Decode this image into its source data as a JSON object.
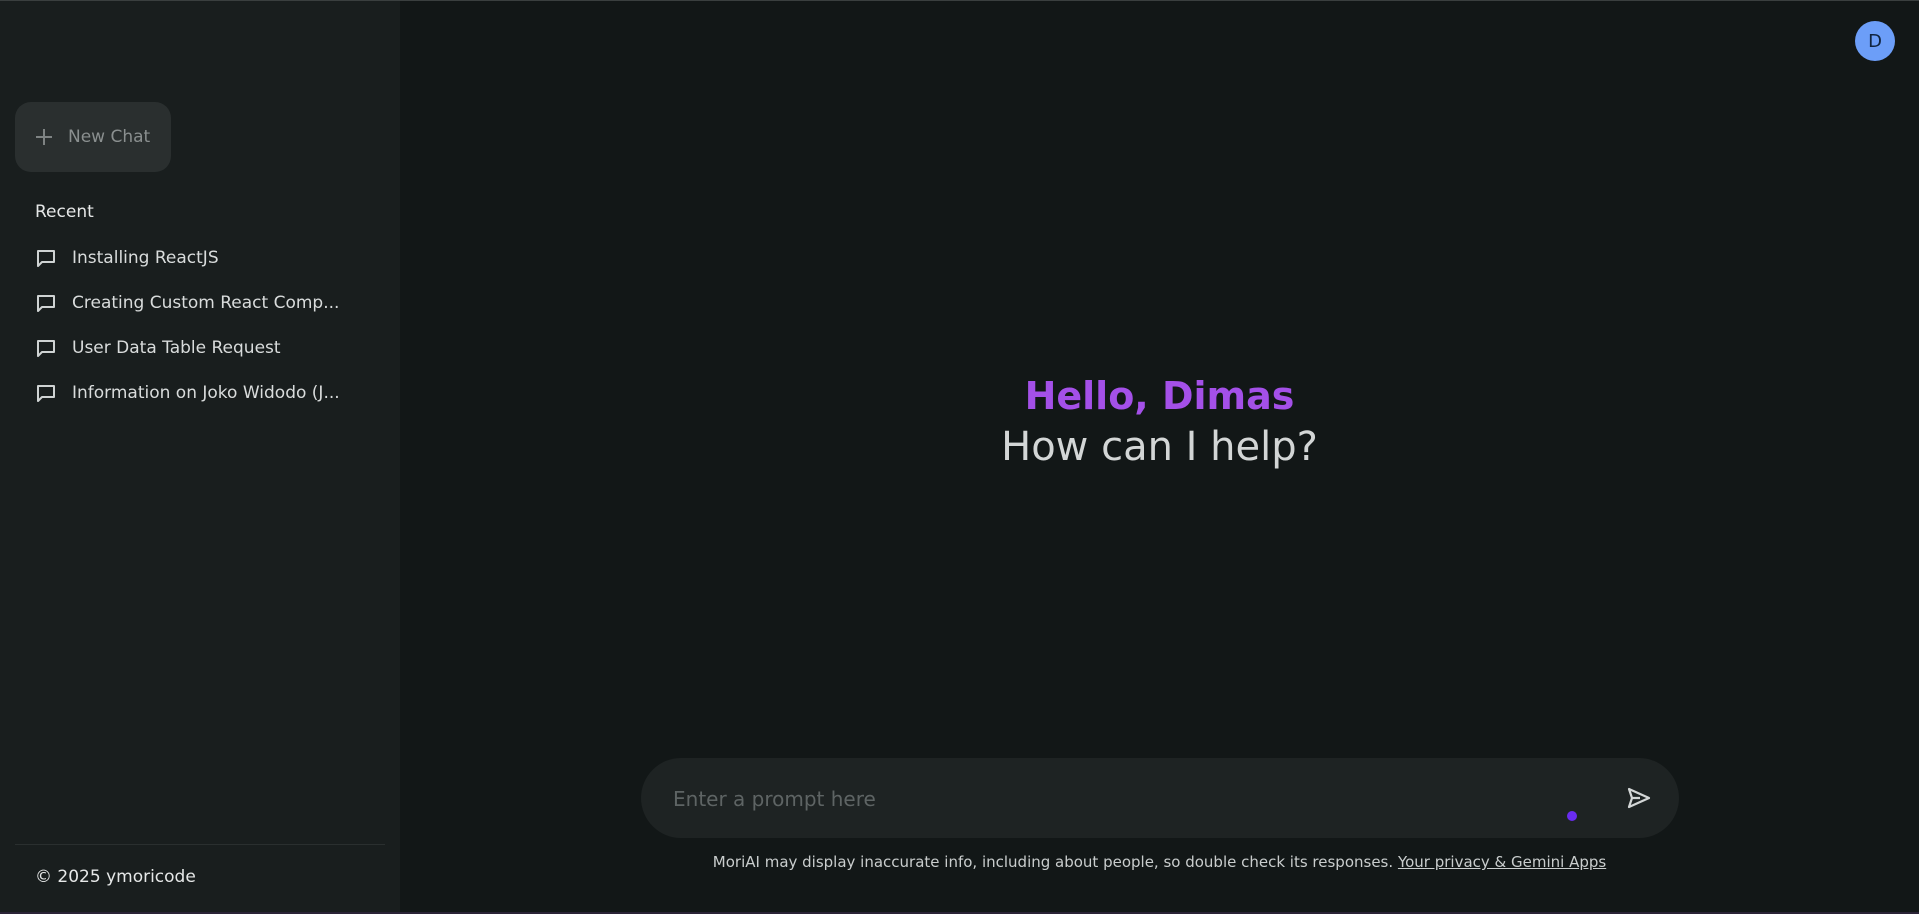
{
  "sidebar": {
    "new_chat_label": "New Chat",
    "recent_title": "Recent",
    "recent_items": [
      {
        "label": "Installing ReactJS"
      },
      {
        "label": "Creating Custom React Comp..."
      },
      {
        "label": "User Data Table Request"
      },
      {
        "label": "Information on Joko Widodo (J..."
      }
    ],
    "copyright": "© 2025 ymoricode"
  },
  "header": {
    "avatar_initial": "D"
  },
  "main": {
    "greeting": "Hello, Dimas",
    "subtitle": "How can I help?"
  },
  "prompt": {
    "placeholder": "Enter a prompt here"
  },
  "footer": {
    "disclaimer": "MoriAI may display inaccurate info, including about people, so double check its responses.",
    "privacy_link": "Your privacy & Gemini Apps"
  },
  "colors": {
    "background": "#121717",
    "sidebar": "#191e1e",
    "greeting_accent": "#a450e8",
    "avatar": "#6c9ef8",
    "indicator_dot": "#6a2cf0"
  }
}
